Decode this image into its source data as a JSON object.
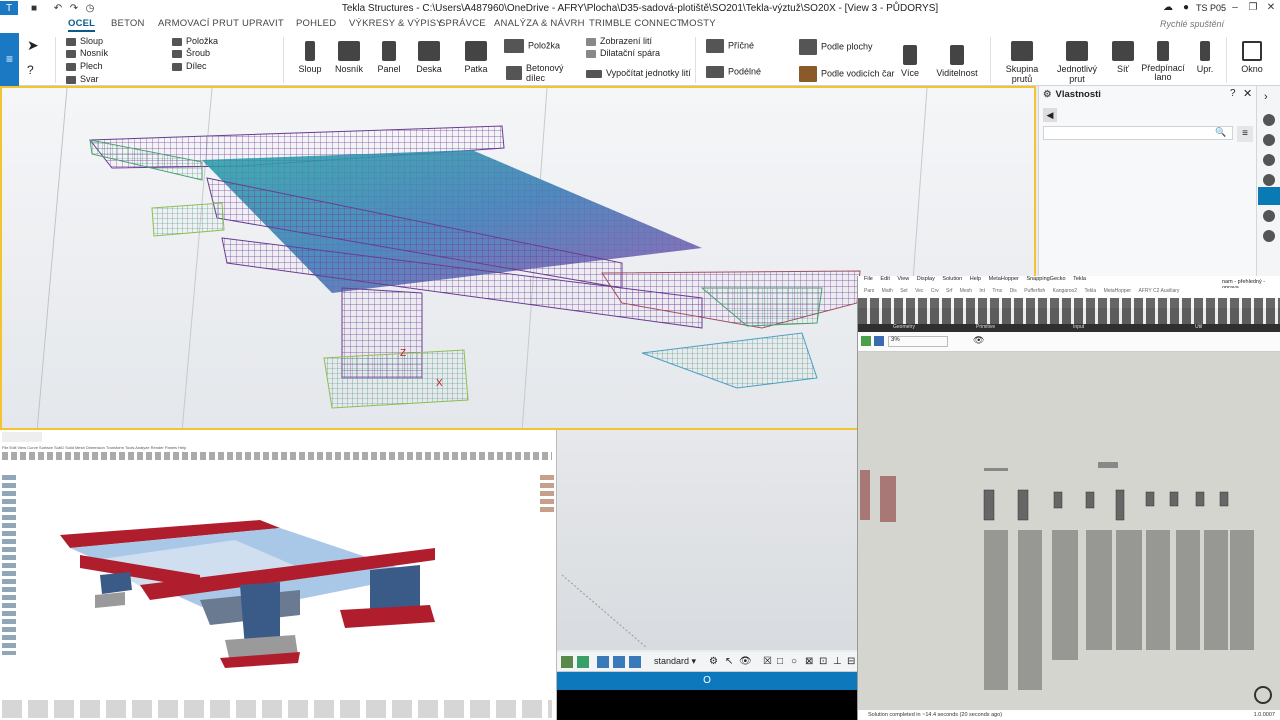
{
  "titlebar": {
    "title": "Tekla Structures - C:\\Users\\A487960\\OneDrive - AFRY\\Plocha\\D35-sadová-plotiště\\SO201\\Tekla-výztuž\\SO20X - [View 3 - PŮDORYS]",
    "user": "TS P05"
  },
  "menu": {
    "tabs": [
      "OCEL",
      "BETON",
      "ARMOVACÍ PRUT",
      "UPRAVIT",
      "POHLED",
      "VÝKRESY & VÝPISY",
      "SPRÁVCE",
      "ANALÝZA & NÁVRH",
      "TRIMBLE CONNECT",
      "MOSTY"
    ],
    "search_placeholder": "Rychlé spuštění"
  },
  "ribbon": {
    "col1": [
      "Sloup",
      "Nosník",
      "Plech",
      "Svar"
    ],
    "col2": [
      "Položka",
      "Šroub",
      "Dílec"
    ],
    "big1": [
      "Sloup",
      "Nosník",
      "Panel",
      "Deska",
      "Patka"
    ],
    "col3": [
      "Položka",
      "Betonový dílec"
    ],
    "col4": [
      "Zobrazení lití",
      "Dilatační spára",
      "Vypočítat jednotky lití"
    ],
    "col5": [
      "Příčné",
      "Podélné"
    ],
    "col6": [
      "Podle plochy",
      "Podle vodicích čar"
    ],
    "big2": [
      "Více",
      "Viditelnost"
    ],
    "big3": [
      "Skupina prutů",
      "Jednotlivý prut",
      "Síť",
      "Předpínací lano",
      "Upr.",
      "Okno"
    ]
  },
  "properties": {
    "title": "Vlastnosti"
  },
  "grasshopper": {
    "menu": [
      "File",
      "Edit",
      "View",
      "Display",
      "Solution",
      "Help",
      "MetaHopper",
      "SnappingGecko",
      "Tekla"
    ],
    "doc": "nam - přehledný - oprava",
    "tabs": [
      "Pars",
      "Math",
      "Set",
      "Vec",
      "Crv",
      "Srf",
      "Mesh",
      "Int",
      "Trns",
      "Dis",
      "Pufferfish",
      "Kangaroo2",
      "Tekla",
      "MetaHopper",
      "AFRY C2 Auxiliary"
    ],
    "groups": [
      "Geometry",
      "Primitive",
      "Input",
      "Util"
    ],
    "zoom": "3%",
    "status": "Solution completed in ~14.4 seconds (20 seconds ago)",
    "version": "1.0.0007"
  },
  "tekla_bottom": {
    "select_value": "standard",
    "status": "O"
  },
  "rhino": {
    "menu": "File  Edit  View  Curve  Surface  SubD  Solid  Mesh  Dimension  Transform  Tools  Analyze  Render  Panels  Help"
  }
}
